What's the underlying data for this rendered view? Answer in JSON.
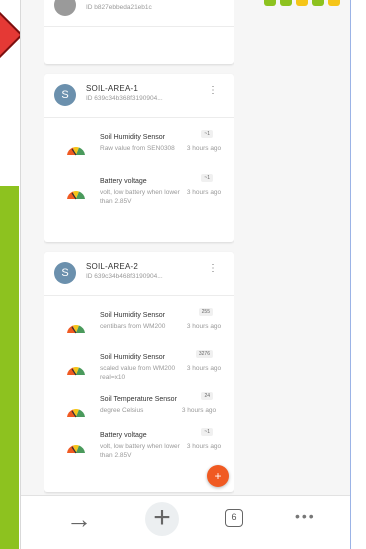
{
  "colors": {
    "accent_green": "#8dc21f",
    "accent_red": "#e53935",
    "fab_orange": "#f05a22",
    "avatar_blue": "#6b90ad",
    "top_bar": [
      "#8dc21f",
      "#8dc21f",
      "#f5c518",
      "#8dc21f",
      "#f5c518"
    ]
  },
  "partial_card": {
    "device_id": "ID b827ebbeda21eb1c"
  },
  "devices": [
    {
      "avatar_letter": "S",
      "name": "SOIL-AREA-1",
      "id": "ID 639c34b368f3190904...",
      "menu_icon": "more-vert-icon",
      "sensors": [
        {
          "title": "Soil Humidity Sensor",
          "desc": "Raw value from SEN0308",
          "time": "3 hours ago",
          "value": "~1",
          "icon": "gauge-icon"
        },
        {
          "title": "Battery voltage",
          "desc": "volt, low battery when lower than 2.85V",
          "time": "3 hours ago",
          "value": "~1",
          "icon": "gauge-icon"
        }
      ]
    },
    {
      "avatar_letter": "S",
      "name": "SOIL-AREA-2",
      "id": "ID 639c34b468f3190904...",
      "menu_icon": "more-vert-icon",
      "sensors": [
        {
          "title": "Soil Humidity Sensor",
          "desc": "centibars from WM200",
          "time": "3 hours ago",
          "value": "255",
          "icon": "gauge-icon"
        },
        {
          "title": "Soil Humidity Sensor",
          "desc": "scaled value from WM200 real=x10",
          "time": "3 hours ago",
          "value": "3276",
          "icon": "gauge-icon"
        },
        {
          "title": "Soil Temperature Sensor",
          "desc": "degree Celsius",
          "time": "3 hours ago",
          "value": "24",
          "icon": "gauge-icon"
        },
        {
          "title": "Battery voltage",
          "desc": "volt, low battery when lower than 2.85V",
          "time": "3 hours ago",
          "value": "~1",
          "icon": "gauge-icon"
        }
      ]
    }
  ],
  "fab": {
    "label": "+"
  },
  "browser_bar": {
    "forward_icon": "arrow-right-icon",
    "new_tab_icon": "plus-icon",
    "tab_count": "6",
    "more_icon": "more-horiz-icon",
    "forward_glyph": "→",
    "plus_glyph": "+",
    "more_glyph": "•••"
  }
}
